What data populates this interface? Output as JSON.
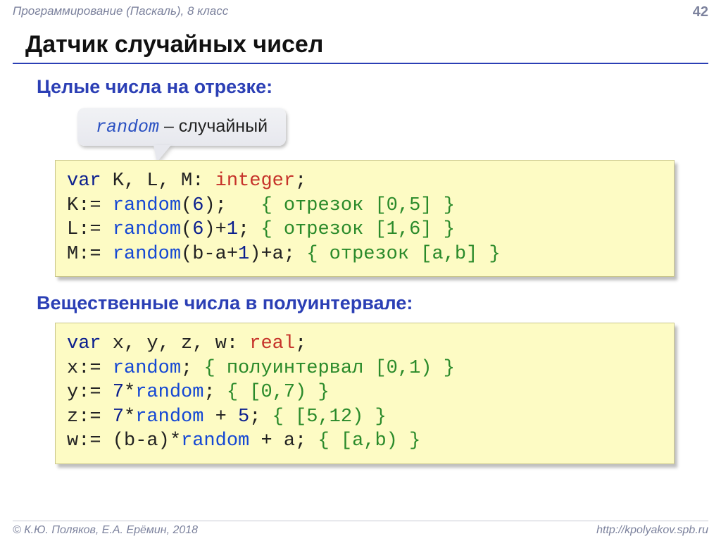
{
  "header": {
    "course": "Программирование (Паскаль), 8 класс",
    "page_number": "42"
  },
  "title": "Датчик случайных чисел",
  "subtitle_int": "Целые числа на отрезке:",
  "subtitle_real": "Вещественные числа в полуинтервале:",
  "callout": {
    "keyword": "random",
    "dash_text": " – случайный"
  },
  "code_int": {
    "l1": {
      "kw": "var",
      "mid": " K, L, M: ",
      "typ": "integer",
      "tail": ";"
    },
    "l2": {
      "pre": "K:= ",
      "fn": "random",
      "args": "(",
      "num": "6",
      "args_close": ");   ",
      "cm": "{ отрезок [0,5] }"
    },
    "l3": {
      "pre": "L:= ",
      "fn": "random",
      "args": "(",
      "num": "6",
      "args_close": ")+",
      "num2": "1",
      "tail": "; ",
      "cm": "{ отрезок [1,6] }"
    },
    "l4": {
      "pre": "M:= ",
      "fn": "random",
      "args": "(b-a+",
      "num": "1",
      "args_close": ")+a; ",
      "cm": "{ отрезок [a,b] }"
    }
  },
  "code_real": {
    "l1": {
      "kw": "var",
      "mid": " x, y, z, w: ",
      "typ": "real",
      "tail": ";"
    },
    "l2": {
      "pre": "x:= ",
      "fn": "random",
      "tail": "; ",
      "cm": "{ полуинтервал [0,1) }"
    },
    "l3": {
      "pre": "y:= ",
      "num": "7",
      "mid": "*",
      "fn": "random",
      "tail": "; ",
      "cm": "{ [0,7) }"
    },
    "l4": {
      "pre": "z:= ",
      "num": "7",
      "mid": "*",
      "fn": "random",
      "mid2": " + ",
      "num2": "5",
      "tail": "; ",
      "cm": "{ [5,12) }"
    },
    "l5": {
      "pre": "w:= (b-a)*",
      "fn": "random",
      "tail": " + a; ",
      "cm": "{ [a,b) }"
    }
  },
  "footer": {
    "authors": "© К.Ю. Поляков, Е.А. Ерёмин, 2018",
    "url": "http://kpolyakov.spb.ru"
  }
}
